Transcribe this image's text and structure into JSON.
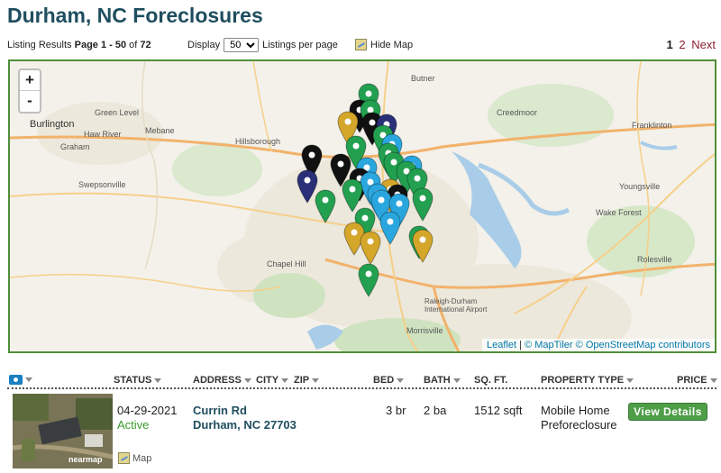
{
  "page_title": "Durham, NC Foreclosures",
  "toolbar": {
    "results_prefix": "Listing Results",
    "results_range": "Page 1 - 50",
    "results_of": "of",
    "results_total": "72",
    "display_label": "Display",
    "display_value": "50",
    "display_suffix": "Listings per page",
    "hide_map": "Hide Map",
    "pages": [
      "1",
      "2"
    ],
    "next": "Next"
  },
  "map": {
    "zoom_in": "+",
    "zoom_out": "-",
    "attribution": {
      "leaflet": "Leaflet",
      "sep1": "|",
      "maptiler": "© MapTiler",
      "osm": "© OpenStreetMap contributors"
    },
    "places": [
      {
        "name": "Burlington",
        "big": true
      },
      {
        "name": "Graham"
      },
      {
        "name": "Hillsborough"
      },
      {
        "name": "Chapel Hill"
      },
      {
        "name": "Wake Forest"
      },
      {
        "name": "Creedmoor"
      },
      {
        "name": "Franklinton"
      },
      {
        "name": "Youngsville"
      },
      {
        "name": "Morrisville"
      },
      {
        "name": "Raleigh-Durham International Airport"
      },
      {
        "name": "Swepsonville"
      },
      {
        "name": "Haw River"
      },
      {
        "name": "Green Level"
      },
      {
        "name": "Mebane"
      },
      {
        "name": "Rolesville"
      },
      {
        "name": "Butner"
      }
    ],
    "pin_colors": {
      "green": "#22a050",
      "gold": "#d4a62a",
      "black": "#111111",
      "navy": "#2b2f78",
      "blue": "#2aa6de"
    }
  },
  "table": {
    "headers": {
      "status": "STATUS",
      "address": "ADDRESS",
      "city": "CITY",
      "zip": "ZIP",
      "bed": "BED",
      "bath": "BATH",
      "sqft": "SQ. FT.",
      "type": "PROPERTY TYPE",
      "price": "PRICE"
    },
    "rows": [
      {
        "date": "04-29-2021",
        "status": "Active",
        "street": "Currin Rd",
        "city_zip": "Durham, NC 27703",
        "bed": "3 br",
        "bath": "2 ba",
        "sqft": "1512 sqft",
        "type_line1": "Mobile Home",
        "type_line2": "Preforeclosure",
        "action": "View Details",
        "map_link": "Map",
        "thumb_brand": "nearmap"
      }
    ]
  }
}
